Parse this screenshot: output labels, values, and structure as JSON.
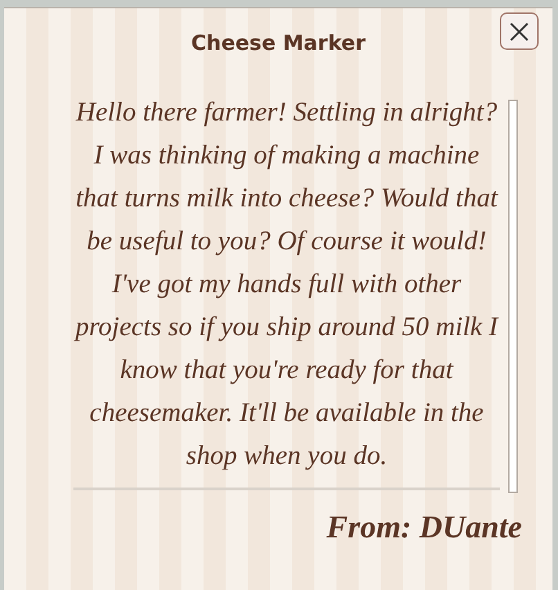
{
  "letter": {
    "title": "Cheese Marker",
    "body": "Hello there farmer! Settling in alright? I was thinking of making a machine that turns milk into cheese? Would that be useful to you? Of course it would! I've got my hands full with other projects so if you ship around 50 milk I know that you're ready for that cheesemaker. It'll be available in the shop when you do.",
    "signature": "From: DUante"
  }
}
